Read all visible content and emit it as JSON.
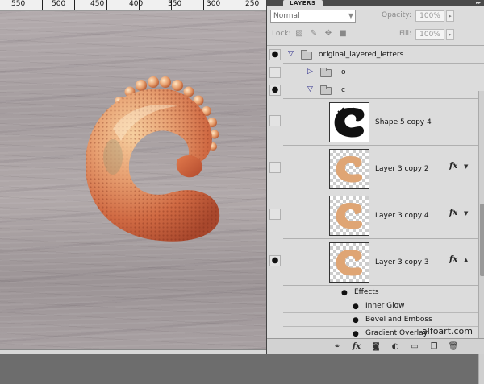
{
  "ruler": {
    "labels": [
      "550",
      "500",
      "450",
      "400",
      "350",
      "300",
      "250"
    ]
  },
  "panel": {
    "tab_label": "LAYERS",
    "blend_mode": "Normal",
    "opacity_label": "Opacity:",
    "opacity_value": "100%",
    "lock_label": "Lock:",
    "fill_label": "Fill:",
    "fill_value": "100%"
  },
  "layers": {
    "group_main": "original_layered_letters",
    "group_o": "o",
    "group_c": "c",
    "shape_layer": "Shape 5 copy 4",
    "layer_a": "Layer 3 copy 2",
    "layer_b": "Layer 3 copy 4",
    "layer_c": "Layer 3 copy 3",
    "fx_symbol": "fx"
  },
  "effects": {
    "header": "Effects",
    "items": [
      "Inner Glow",
      "Bevel and Emboss",
      "Gradient Overlay"
    ]
  },
  "watermark": "alfoart.com",
  "colors": {
    "panel_bg": "#dcdcdc",
    "canvas_bg": "#a9a1a3",
    "letter_orange": "#d2774a",
    "letter_light": "#f3c493"
  },
  "icons": [
    "eye-icon",
    "folder-icon",
    "link-icon",
    "fx-icon",
    "mask-icon",
    "adjustment-icon",
    "new-group-icon",
    "new-layer-icon",
    "trash-icon"
  ]
}
